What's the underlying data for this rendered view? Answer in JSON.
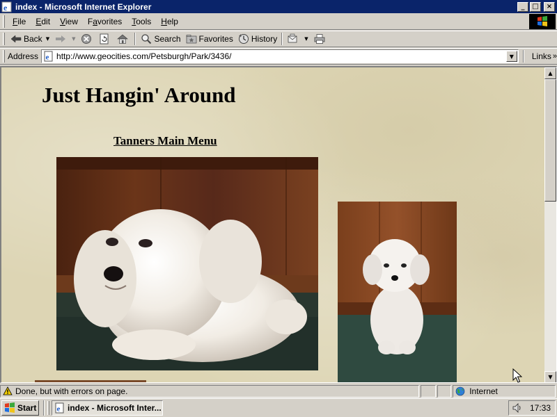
{
  "window": {
    "title": "index - Microsoft Internet Explorer",
    "controls": {
      "minimize": "_",
      "maximize": "□",
      "close": "×"
    }
  },
  "menubar": {
    "items": [
      {
        "label": "File",
        "accel": "F"
      },
      {
        "label": "Edit",
        "accel": "E"
      },
      {
        "label": "View",
        "accel": "V"
      },
      {
        "label": "Favorites",
        "accel": "a"
      },
      {
        "label": "Tools",
        "accel": "T"
      },
      {
        "label": "Help",
        "accel": "H"
      }
    ]
  },
  "toolbar": {
    "back_label": "Back",
    "search_label": "Search",
    "favorites_label": "Favorites",
    "history_label": "History"
  },
  "address": {
    "label": "Address",
    "url": "http://www.geocities.com/Petsburgh/Park/3436/",
    "links_label": "Links",
    "links_more": "»"
  },
  "page": {
    "heading": "Just Hangin' Around",
    "main_menu_link": "Tanners Main Menu"
  },
  "statusbar": {
    "message": "Done, but with errors on page.",
    "zone": "Internet"
  },
  "taskbar": {
    "start_label": "Start",
    "task_label": "index - Microsoft Inter...",
    "clock": "17:33"
  },
  "colors": {
    "titlebar": "#0a246a",
    "chrome": "#d4d0c8",
    "page_background": "#ddd5b4"
  },
  "icons": [
    "ie-icon",
    "back-arrow-icon",
    "forward-arrow-icon",
    "stop-icon",
    "refresh-icon",
    "home-icon",
    "search-icon",
    "favorites-icon",
    "history-icon",
    "mail-icon",
    "print-icon",
    "page-icon",
    "windows-flag-icon",
    "warning-icon",
    "globe-icon",
    "speaker-icon",
    "mouse-cursor-icon"
  ]
}
